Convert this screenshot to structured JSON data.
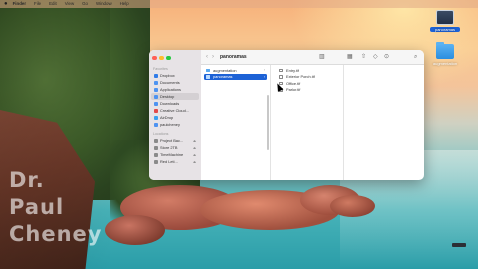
{
  "menubar": {
    "app": "Finder",
    "items": [
      "File",
      "Edit",
      "View",
      "Go",
      "Window",
      "Help"
    ]
  },
  "desktop_icons": [
    {
      "label": "panoramas",
      "selected": true,
      "kind": "screen"
    },
    {
      "label": "augmentation",
      "selected": false,
      "kind": "folder"
    }
  ],
  "watermark": [
    "Dr.",
    "Paul",
    "Cheney"
  ],
  "finder": {
    "title": "panoramas",
    "sidebar": {
      "favorites_header": "Favorites",
      "favorites": [
        {
          "label": "Dropbox",
          "color": "#2f7be8",
          "active": false
        },
        {
          "label": "Documents",
          "color": "#4e93f1",
          "active": false
        },
        {
          "label": "Applications",
          "color": "#4e93f1",
          "active": false
        },
        {
          "label": "Desktop",
          "color": "#4e93f1",
          "active": true
        },
        {
          "label": "Downloads",
          "color": "#4e93f1",
          "active": false
        },
        {
          "label": "Creative Cloud...",
          "color": "#e34a4a",
          "active": false
        },
        {
          "label": "AirDrop",
          "color": "#3aa0f0",
          "active": false
        },
        {
          "label": "paulcheney",
          "color": "#4e93f1",
          "active": false
        }
      ],
      "locations_header": "Locations",
      "locations": [
        {
          "label": "Project Bac...",
          "color": "#8a8a8a"
        },
        {
          "label": "Store 2TB",
          "color": "#8a8a8a"
        },
        {
          "label": "TimeMachine",
          "color": "#8a8a8a"
        },
        {
          "label": "Red Leti...",
          "color": "#8a8a8a"
        }
      ]
    },
    "column1": [
      {
        "label": "augmentation",
        "selected": false
      },
      {
        "label": "panoramas",
        "selected": true
      }
    ],
    "column2": [
      {
        "label": "Entry.tif"
      },
      {
        "label": "Exterior Porch.tif"
      },
      {
        "label": "Office.tif"
      },
      {
        "label": "Parlor.tif"
      }
    ]
  }
}
